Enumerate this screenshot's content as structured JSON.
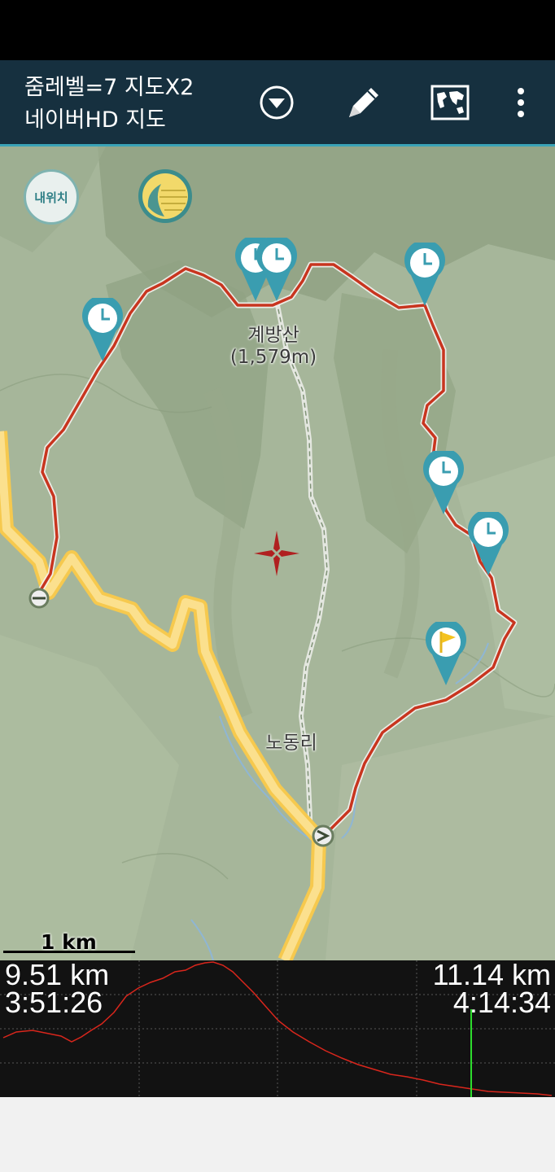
{
  "toolbar": {
    "title_line1": "줌레벨=7 지도X2",
    "title_line2": "네이버HD 지도",
    "dropdown_icon": "chevron-down-circle-icon",
    "edit_icon": "pencil-icon",
    "map_icon": "world-map-icon",
    "more_icon": "more-vert-icon",
    "accent": "#3aa3b7",
    "background": "#16303f"
  },
  "map": {
    "my_location_label": "내위치",
    "layer_toggle_icon": "map-layer-icon",
    "peak_name": "계방산",
    "peak_elevation": "(1,579m)",
    "village_name": "노동리",
    "scale_label": "1 km",
    "track_color": "#c8351f",
    "waypoint_markers": [
      "clock",
      "clock",
      "clock",
      "clock",
      "clock",
      "clock"
    ],
    "flag_marker": "flag",
    "crosshair_icon": "crosshair-icon"
  },
  "profile": {
    "left_distance": "9.51 km",
    "left_time": "3:51:26",
    "right_distance": "11.14 km",
    "right_time": "4:14:34",
    "line_color": "#d9261c",
    "cursor_color": "#2ddc2d"
  }
}
